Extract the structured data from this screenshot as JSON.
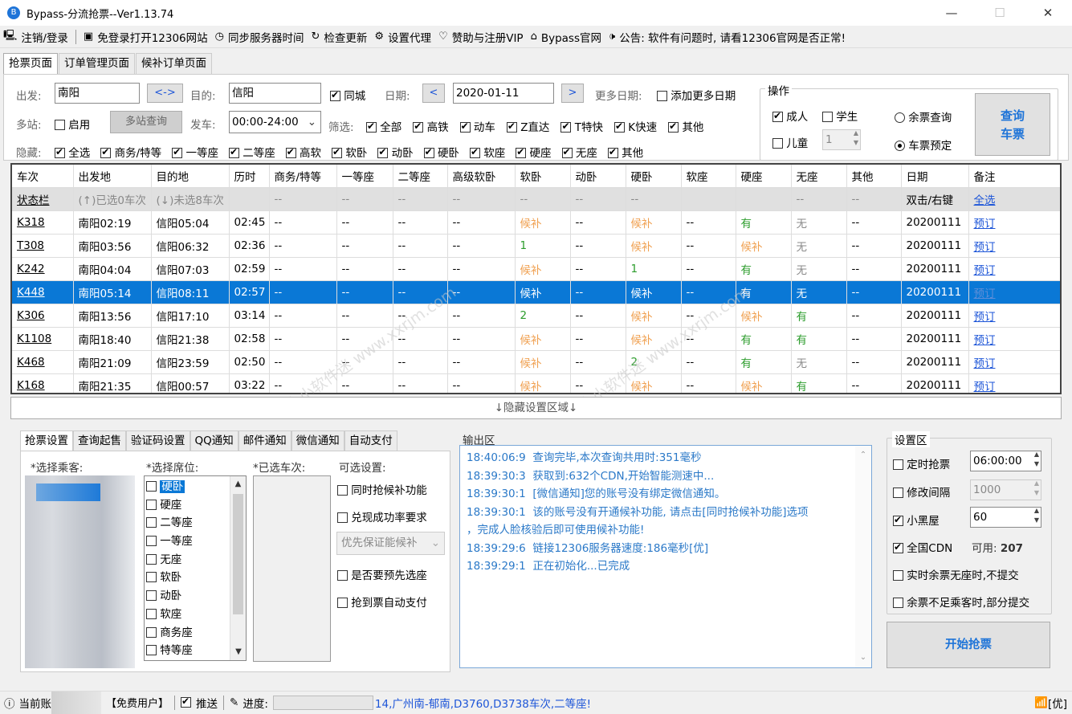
{
  "window": {
    "title": "Bypass-分流抢票--Ver1.13.74",
    "app_icon": "bypass-logo-icon"
  },
  "menu": [
    {
      "icon": "monitor-icon",
      "glyph": "🖳",
      "label": "注销/登录"
    },
    {
      "icon": "window-icon",
      "glyph": "▣",
      "label": "免登录打开12306网站"
    },
    {
      "icon": "clock-icon",
      "glyph": "◷",
      "label": "同步服务器时间"
    },
    {
      "icon": "refresh-icon",
      "glyph": "↻",
      "label": "检查更新"
    },
    {
      "icon": "gear-icon",
      "glyph": "⚙",
      "label": "设置代理"
    },
    {
      "icon": "heart-icon",
      "glyph": "♡",
      "label": "赞助与注册VIP"
    },
    {
      "icon": "home-icon",
      "glyph": "⌂",
      "label": "Bypass官网"
    },
    {
      "icon": "speaker-icon",
      "glyph": "🕩",
      "label": "公告: 软件有问题时, 请看12306官网是否正常!"
    }
  ],
  "top_tabs": [
    "抢票页面",
    "订单管理页面",
    "候补订单页面"
  ],
  "query": {
    "from_label": "出发:",
    "from_value": "南阳",
    "swap": "<->",
    "to_label": "目的:",
    "to_value": "信阳",
    "same_city": "同城",
    "date_label": "日期:",
    "prev": "<",
    "date_value": "2020-01-11",
    "next": ">",
    "more_dates_label": "更多日期:",
    "add_more_dates": "添加更多日期",
    "multi_label": "多站:",
    "enable": "启用",
    "multi_query": "多站查询",
    "depart_label": "发车:",
    "depart_value": "00:00-24:00",
    "filter_label": "筛选:",
    "filters": [
      "全部",
      "高铁",
      "动车",
      "Z直达",
      "T特快",
      "K快速",
      "其他"
    ],
    "hide_label": "隐藏:",
    "hide_items": [
      "全选",
      "商务/特等",
      "一等座",
      "二等座",
      "高软",
      "软卧",
      "动卧",
      "硬卧",
      "软座",
      "硬座",
      "无座",
      "其他"
    ]
  },
  "ops": {
    "title": "操作",
    "adult": "成人",
    "student": "学生",
    "child": "儿童",
    "child_count": "1",
    "remain_query": "余票查询",
    "reserve": "车票预定",
    "query_btn_line1": "查询",
    "query_btn_line2": "车票"
  },
  "table": {
    "headers": [
      "车次",
      "出发地",
      "目的地",
      "历时",
      "商务/特等",
      "一等座",
      "二等座",
      "高级软卧",
      "软卧",
      "动卧",
      "硬卧",
      "软座",
      "硬座",
      "无座",
      "其他",
      "日期",
      "备注"
    ],
    "status_row": {
      "a": "状态栏",
      "b": "(↑)已选0车次",
      "c": "(↓)未选8车次",
      "dash": "--",
      "date": "双击/右键",
      "note": "全选"
    },
    "rows": [
      {
        "train": "K318",
        "from": "南阳02:19",
        "to": "信阳05:04",
        "dur": "02:45",
        "rw": "候补",
        "yw": "候补",
        "yz": "有",
        "wz": "无",
        "date": "20200111",
        "note": "预订"
      },
      {
        "train": "T308",
        "from": "南阳03:56",
        "to": "信阳06:32",
        "dur": "02:36",
        "rw": "1",
        "yw": "候补",
        "yz": "候补",
        "wz": "无",
        "date": "20200111",
        "note": "预订"
      },
      {
        "train": "K242",
        "from": "南阳04:04",
        "to": "信阳07:03",
        "dur": "02:59",
        "rw": "候补",
        "yw": "1",
        "yz": "有",
        "wz": "无",
        "date": "20200111",
        "note": "预订"
      },
      {
        "train": "K448",
        "from": "南阳05:14",
        "to": "信阳08:11",
        "dur": "02:57",
        "rw": "候补",
        "yw": "候补",
        "yz": "有",
        "wz": "无",
        "date": "20200111",
        "note": "预订"
      },
      {
        "train": "K306",
        "from": "南阳13:56",
        "to": "信阳17:10",
        "dur": "03:14",
        "rw": "2",
        "yw": "候补",
        "yz": "候补",
        "wz": "有",
        "date": "20200111",
        "note": "预订"
      },
      {
        "train": "K1108",
        "from": "南阳18:40",
        "to": "信阳21:38",
        "dur": "02:58",
        "rw": "候补",
        "yw": "候补",
        "yz": "有",
        "wz": "有",
        "date": "20200111",
        "note": "预订"
      },
      {
        "train": "K468",
        "from": "南阳21:09",
        "to": "信阳23:59",
        "dur": "02:50",
        "rw": "候补",
        "yw": "2",
        "yz": "有",
        "wz": "无",
        "date": "20200111",
        "note": "预订"
      },
      {
        "train": "K168",
        "from": "南阳21:35",
        "to": "信阳00:57",
        "dur": "03:22",
        "rw": "候补",
        "yw": "候补",
        "yz": "候补",
        "wz": "有",
        "date": "20200111",
        "note": "预订"
      }
    ],
    "dash": "--",
    "selected_train": "K448"
  },
  "hide_settings": "↓隐藏设置区域↓",
  "watermark": "小小软件迷 www.xxrjm.com",
  "bottom_tabs": [
    "抢票设置",
    "查询起售",
    "验证码设置",
    "QQ通知",
    "邮件通知",
    "微信通知",
    "自动支付"
  ],
  "settings": {
    "passenger_label": "*选择乘客:",
    "seat_label": "*选择席位:",
    "trains_label": "*已选车次:",
    "optional_label": "可选设置:",
    "seats": [
      "硬卧",
      "硬座",
      "二等座",
      "一等座",
      "无座",
      "软卧",
      "动卧",
      "软座",
      "商务座",
      "特等座"
    ],
    "opt_items": [
      "同时抢候补功能",
      "兑现成功率要求"
    ],
    "priority": "优先保证能候补",
    "opt_items2": [
      "是否要预先选座",
      "抢到票自动支付"
    ]
  },
  "output": {
    "title": "输出区",
    "lines": [
      "18:40:06:9  查询完毕,本次查询共用时:351毫秒",
      "18:39:30:3  获取到:632个CDN,开始智能测速中...",
      "18:39:30:1  [微信通知]您的账号没有绑定微信通知。",
      "18:39:30:1  该的账号没有开通候补功能, 请点击[同时抢候补功能]选项",
      "，完成人脸核验后即可使用候补功能!",
      "18:39:29:6  链接12306服务器速度:186毫秒[优]",
      "18:39:29:1  正在初始化...已完成"
    ]
  },
  "setup": {
    "title": "设置区",
    "timed": "定时抢票",
    "timed_value": "06:00:00",
    "interval": "修改间隔",
    "interval_value": "1000",
    "blackroom": "小黑屋",
    "blackroom_value": "60",
    "cdn": "全国CDN",
    "cdn_available_label": "可用:",
    "cdn_available": "207",
    "no_seat": "实时余票无座时,不提交",
    "partial": "余票不足乘客时,部分提交",
    "start": "开始抢票"
  },
  "status": {
    "account": "当前账",
    "user_type": "【免费用户】",
    "push": "推送",
    "progress": "进度:",
    "scroll_text": "14,广州南-郁南,D3760,D3738车次,二等座!",
    "net": "[优]"
  }
}
